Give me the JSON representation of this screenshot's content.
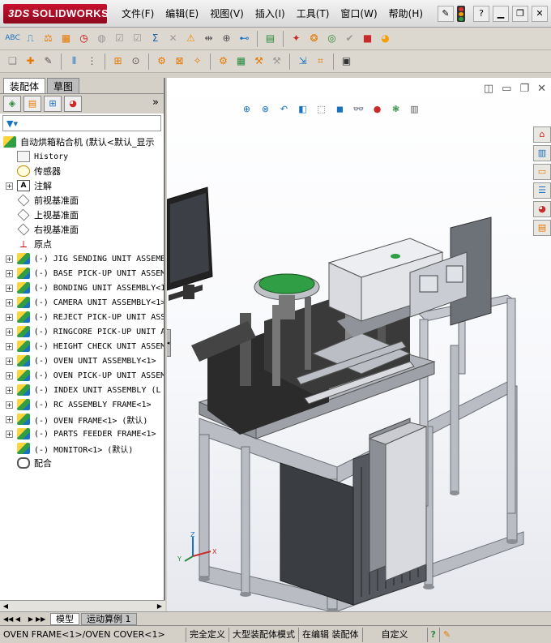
{
  "app": {
    "logo_prefix": "3DS",
    "logo_text": "SOLIDWORKS"
  },
  "menu": [
    "文件(F)",
    "编辑(E)",
    "视图(V)",
    "插入(I)",
    "工具(T)",
    "窗口(W)",
    "帮助(H)"
  ],
  "title_icons": [
    "pushpin-icon",
    "help-icon",
    "minimize-icon",
    "restore-icon",
    "close-icon"
  ],
  "colors": {
    "brand": "#c8102e",
    "machine_frame": "#b9bcc2",
    "bowl_feeder": "#2f9e44",
    "dark_body": "#2b2b2b"
  },
  "panel_tabs": {
    "assembly": "装配体",
    "drawing": "草图"
  },
  "feature_tree": {
    "root": "自动烘箱粘合机  (默认<默认_显示",
    "items": [
      {
        "type": "history",
        "label": "History",
        "mono": true,
        "expand": false
      },
      {
        "type": "sensor",
        "label": "传感器",
        "mono": false,
        "expand": false
      },
      {
        "type": "annotation",
        "label": "注解",
        "mono": false,
        "expand": true
      },
      {
        "type": "plane",
        "label": "前视基准面",
        "mono": false,
        "expand": false
      },
      {
        "type": "plane",
        "label": "上视基准面",
        "mono": false,
        "expand": false
      },
      {
        "type": "plane",
        "label": "右视基准面",
        "mono": false,
        "expand": false
      },
      {
        "type": "origin",
        "label": "原点",
        "mono": false,
        "expand": false
      },
      {
        "type": "asm",
        "label": "(-) JIG SENDING UNIT ASSEMB",
        "mono": true,
        "expand": true
      },
      {
        "type": "asm",
        "label": "(-) BASE PICK-UP UNIT ASSEM",
        "mono": true,
        "expand": true
      },
      {
        "type": "asm",
        "label": "(-) BONDING UNIT ASSEMBLY<1>",
        "mono": true,
        "expand": true
      },
      {
        "type": "asm",
        "label": "(-) CAMERA UNIT ASSEMBLY<1>",
        "mono": true,
        "expand": true
      },
      {
        "type": "asm",
        "label": "(-) REJECT PICK-UP UNIT ASS",
        "mono": true,
        "expand": true
      },
      {
        "type": "asm",
        "label": "(-) RINGCORE PICK-UP UNIT A",
        "mono": true,
        "expand": true
      },
      {
        "type": "asm",
        "label": "(-) HEIGHT CHECK UNIT ASSEM",
        "mono": true,
        "expand": true
      },
      {
        "type": "asm",
        "label": "(-) OVEN UNIT ASSEMBLY<1>",
        "mono": true,
        "expand": true
      },
      {
        "type": "asm",
        "label": "(-) OVEN PICK-UP UNIT ASSEM",
        "mono": true,
        "expand": true
      },
      {
        "type": "asm",
        "label": "(-) INDEX UNIT ASSEMBLY (L",
        "mono": true,
        "expand": true
      },
      {
        "type": "asm",
        "label": "(-) RC ASSEMBLY  FRAME<1>",
        "mono": true,
        "expand": true
      },
      {
        "type": "asm",
        "label": "(-) OVEN FRAME<1> (默认)",
        "mono": true,
        "expand": true
      },
      {
        "type": "asm",
        "label": "(-) PARTS FEEDER FRAME<1>",
        "mono": true,
        "expand": true
      },
      {
        "type": "asm",
        "label": "(-) MONITOR<1> (默认)",
        "mono": true,
        "expand": false
      },
      {
        "type": "mate",
        "label": "配合",
        "mono": false,
        "expand": false
      }
    ]
  },
  "bottom_tabs": {
    "model": "模型",
    "motion": "运动算例 1"
  },
  "status": {
    "selection": "OVEN FRAME<1>/OVEN COVER<1>",
    "defined": "完全定义",
    "mode": "大型装配体模式",
    "editing": "在编辑 装配体",
    "custom": "自定义",
    "help": "?"
  }
}
